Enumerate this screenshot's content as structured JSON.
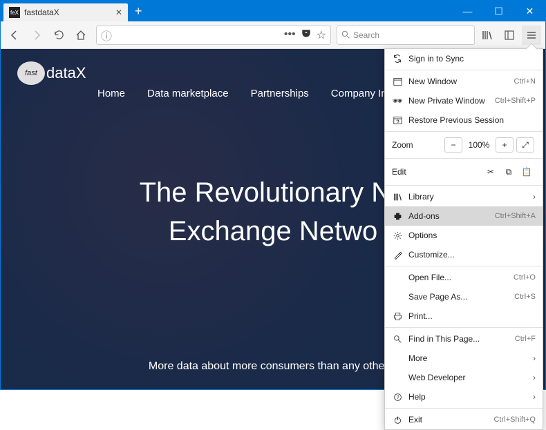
{
  "tab": {
    "title": "fastdataX",
    "favicon": "feX"
  },
  "toolbar": {
    "search_placeholder": "Search",
    "url_info": "ⓘ"
  },
  "page": {
    "logo_badge": "fast",
    "logo_text": "dataX",
    "nav": [
      "Home",
      "Data marketplace",
      "Partnerships",
      "Company Info"
    ],
    "hero_line1": "The Revolutionary Ne",
    "hero_line2": "Exchange Netwo",
    "subtitle": "More data about more consumers than any other d"
  },
  "menu": {
    "sign_in": "Sign in to Sync",
    "new_window": {
      "label": "New Window",
      "shortcut": "Ctrl+N"
    },
    "new_private": {
      "label": "New Private Window",
      "shortcut": "Ctrl+Shift+P"
    },
    "restore": "Restore Previous Session",
    "zoom": {
      "label": "Zoom",
      "value": "100%"
    },
    "edit": "Edit",
    "library": "Library",
    "addons": {
      "label": "Add-ons",
      "shortcut": "Ctrl+Shift+A"
    },
    "options": "Options",
    "customize": "Customize...",
    "open_file": {
      "label": "Open File...",
      "shortcut": "Ctrl+O"
    },
    "save_as": {
      "label": "Save Page As...",
      "shortcut": "Ctrl+S"
    },
    "print": "Print...",
    "find": {
      "label": "Find in This Page...",
      "shortcut": "Ctrl+F"
    },
    "more": "More",
    "webdev": "Web Developer",
    "help": "Help",
    "exit": {
      "label": "Exit",
      "shortcut": "Ctrl+Shift+Q"
    }
  }
}
